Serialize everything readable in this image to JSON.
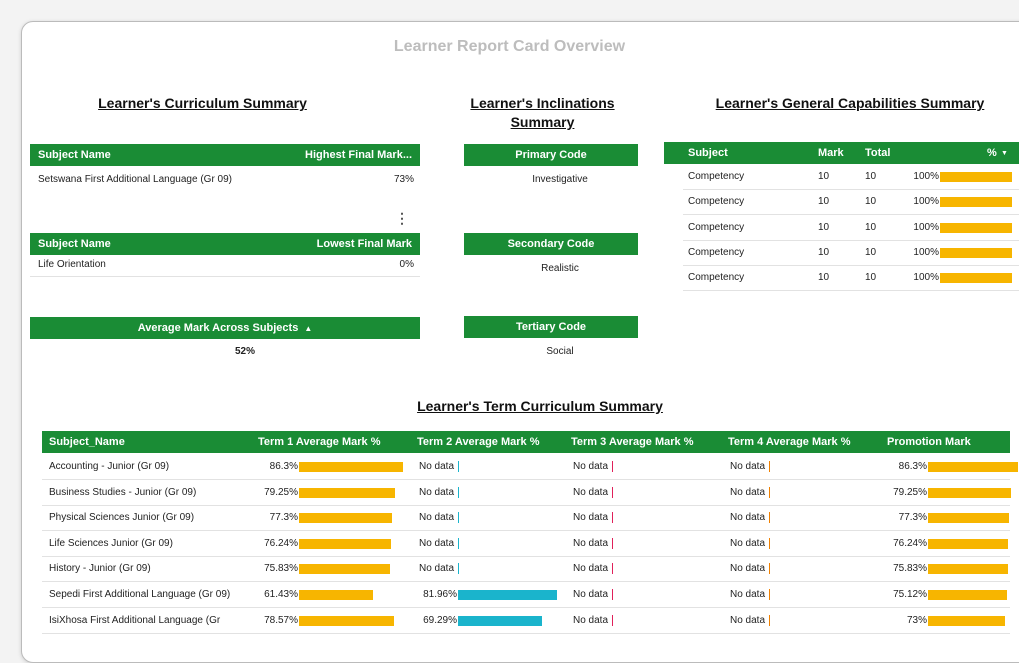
{
  "page_title": "Learner Report Card Overview",
  "curriculum": {
    "title": "Learner's Curriculum Summary",
    "highest": {
      "col1": "Subject Name",
      "col2": "Highest Final Mark...",
      "subject": "Setswana First Additional Language (Gr 09)",
      "mark": "73%"
    },
    "lowest": {
      "col1": "Subject Name",
      "col2": "Lowest Final Mark",
      "subject": "Life Orientation",
      "mark": "0%"
    },
    "average": {
      "header": "Average Mark Across Subjects",
      "value": "52%"
    }
  },
  "inclinations": {
    "title_line1": "Learner's Inclinations",
    "title_line2": "Summary",
    "primary": {
      "header": "Primary Code",
      "value": "Investigative"
    },
    "secondary": {
      "header": "Secondary Code",
      "value": "Realistic"
    },
    "tertiary": {
      "header": "Tertiary Code",
      "value": "Social"
    }
  },
  "capabilities": {
    "title": "Learner's General Capabilities Summary",
    "headers": [
      "Subject",
      "Mark",
      "Total",
      "%"
    ],
    "rows": [
      {
        "subject": "Competency",
        "mark": "10",
        "total": "10",
        "pct": "100%",
        "pct_value": 1.0
      },
      {
        "subject": "Competency",
        "mark": "10",
        "total": "10",
        "pct": "100%",
        "pct_value": 1.0
      },
      {
        "subject": "Competency",
        "mark": "10",
        "total": "10",
        "pct": "100%",
        "pct_value": 1.0
      },
      {
        "subject": "Competency",
        "mark": "10",
        "total": "10",
        "pct": "100%",
        "pct_value": 1.0
      },
      {
        "subject": "Competency",
        "mark": "10",
        "total": "10",
        "pct": "100%",
        "pct_value": 1.0
      }
    ]
  },
  "term": {
    "title": "Learner's Term Curriculum Summary",
    "headers": [
      "Subject_Name",
      "Term 1 Average Mark %",
      "Term 2 Average Mark %",
      "Term 3 Average Mark %",
      "Term 4 Average Mark %",
      "Promotion Mark"
    ],
    "no_data": "No data",
    "rows": [
      {
        "subject": "Accounting - Junior (Gr 09)",
        "t1": "86.3%",
        "t1v": 86.3,
        "t2": "No data",
        "t2v": null,
        "t3": "No data",
        "t4": "No data",
        "promo": "86.3%",
        "promov": 86.3
      },
      {
        "subject": "Business Studies - Junior (Gr 09)",
        "t1": "79.25%",
        "t1v": 79.25,
        "t2": "No data",
        "t2v": null,
        "t3": "No data",
        "t4": "No data",
        "promo": "79.25%",
        "promov": 79.25
      },
      {
        "subject": "Physical Sciences Junior (Gr 09)",
        "t1": "77.3%",
        "t1v": 77.3,
        "t2": "No data",
        "t2v": null,
        "t3": "No data",
        "t4": "No data",
        "promo": "77.3%",
        "promov": 77.3
      },
      {
        "subject": "Life Sciences Junior (Gr 09)",
        "t1": "76.24%",
        "t1v": 76.24,
        "t2": "No data",
        "t2v": null,
        "t3": "No data",
        "t4": "No data",
        "promo": "76.24%",
        "promov": 76.24
      },
      {
        "subject": "History - Junior (Gr 09)",
        "t1": "75.83%",
        "t1v": 75.83,
        "t2": "No data",
        "t2v": null,
        "t3": "No data",
        "t4": "No data",
        "promo": "75.83%",
        "promov": 75.83
      },
      {
        "subject": "Sepedi First Additional Language (Gr 09)",
        "t1": "61.43%",
        "t1v": 61.43,
        "t2": "81.96%",
        "t2v": 81.96,
        "t3": "No data",
        "t4": "No data",
        "promo": "75.12%",
        "promov": 75.12
      },
      {
        "subject": "IsiXhosa First Additional Language (Gr",
        "t1": "78.57%",
        "t1v": 78.57,
        "t2": "69.29%",
        "t2v": 69.29,
        "t3": "No data",
        "t4": "No data",
        "promo": "73%",
        "promov": 73
      }
    ]
  },
  "colors": {
    "header_green": "#1a8c35",
    "bar_yellow": "#f7b500",
    "bar_cyan": "#1ab4cc"
  }
}
